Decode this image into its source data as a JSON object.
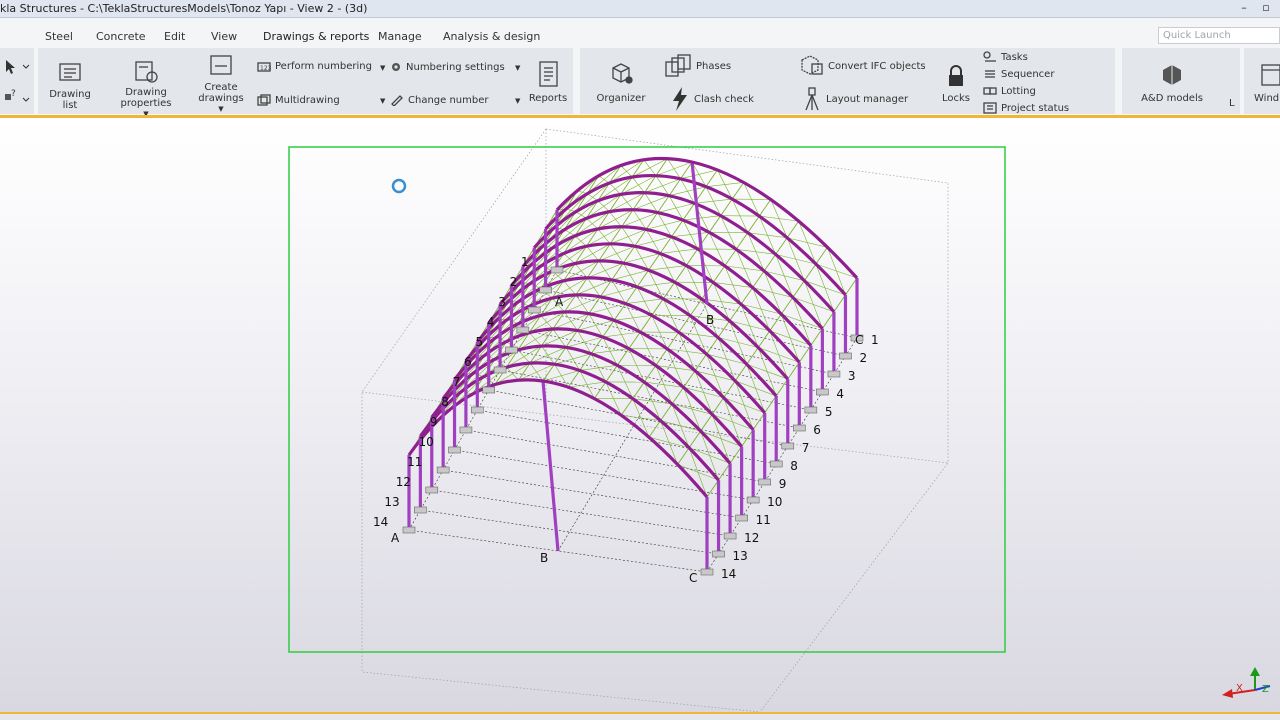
{
  "window": {
    "title": "kla Structures - C:\\TeklaStructuresModels\\Tonoz Yapı  - View 2 - (3d)",
    "minimize": "–",
    "restore": "▫"
  },
  "menu": {
    "tabs": [
      "Steel",
      "Concrete",
      "Edit",
      "View",
      "Drawings & reports",
      "Manage",
      "Analysis & design"
    ],
    "active_tab": "Drawings & reports"
  },
  "quick_launch": {
    "placeholder": "Quick Launch"
  },
  "ribbon": {
    "drawing_list": "Drawing list",
    "drawing_properties_1": "Drawing",
    "drawing_properties_2": "properties",
    "create_drawings_1": "Create",
    "create_drawings_2": "drawings",
    "perform_numbering": "Perform numbering",
    "multidrawing": "Multidrawing",
    "numbering_settings": "Numbering settings",
    "change_number": "Change number",
    "reports": "Reports",
    "organizer": "Organizer",
    "phases": "Phases",
    "clash_check": "Clash check",
    "convert_ifc": "Convert IFC objects",
    "layout_manager": "Layout manager",
    "locks": "Locks",
    "tasks": "Tasks",
    "sequencer": "Sequencer",
    "lotting": "Lotting",
    "project_status": "Project status",
    "ad_models": "A&D models",
    "cut_l": "L",
    "cut_wind": "Wind"
  },
  "model": {
    "grid_numbers_left": [
      "1",
      "2",
      "3",
      "4",
      "5",
      "6",
      "7",
      "8",
      "9",
      "10",
      "11",
      "12",
      "13",
      "14"
    ],
    "grid_numbers_right": [
      "1",
      "2",
      "3",
      "4",
      "5",
      "6",
      "7",
      "8",
      "9",
      "10",
      "11",
      "12",
      "13",
      "14"
    ],
    "grid_letters": [
      "A",
      "B",
      "C"
    ],
    "colors": {
      "members": "#8f1f8f",
      "columns": "#a040c0",
      "bracing": "#78b428",
      "selection_frame": "#2ecc40",
      "accent": "#f2b637"
    }
  },
  "axes": {
    "x": "X",
    "z": "Z"
  }
}
